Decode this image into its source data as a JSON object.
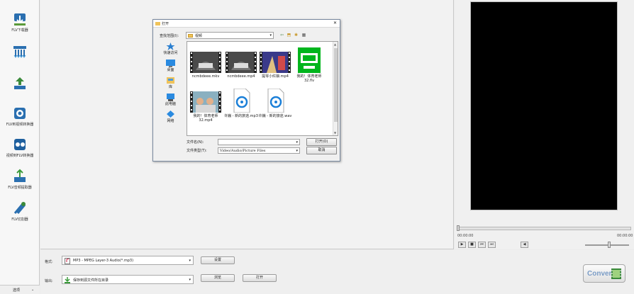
{
  "sidebar": {
    "items": [
      {
        "label": "FLV下载器",
        "icon": "download-icon"
      },
      {
        "label": "",
        "icon": "batch-convert-icon"
      },
      {
        "label": "",
        "icon": "upload-icon"
      },
      {
        "label": "FLV到视频转换器",
        "icon": "flv-to-video-icon"
      },
      {
        "label": "视频到FLV转换器",
        "icon": "video-to-flv-icon"
      },
      {
        "label": "FLV音频提取器",
        "icon": "audio-extract-icon"
      },
      {
        "label": "FLV切割器",
        "icon": "cutter-icon"
      }
    ],
    "footer_label": "选项",
    "footer_arrow": "⌄"
  },
  "dialog": {
    "title": "打开",
    "close": "✕",
    "look_in_label": "查找范围(I):",
    "look_in_value": "视频",
    "places": [
      {
        "label": "快速访问",
        "icon": "star-icon"
      },
      {
        "label": "桌面",
        "icon": "desktop-icon"
      },
      {
        "label": "库",
        "icon": "library-icon"
      },
      {
        "label": "此电脑",
        "icon": "computer-icon"
      },
      {
        "label": "网络",
        "icon": "network-icon"
      }
    ],
    "files": [
      {
        "name": "ncmbdeee.mkv",
        "kind": "video"
      },
      {
        "name": "ncmbdeee.mp4",
        "kind": "video"
      },
      {
        "name": "提琴小红娘.mp4",
        "kind": "concert"
      },
      {
        "name": "我的！体育老师32.flv",
        "kind": "iqiyi"
      },
      {
        "name": "我的！体育老师32.mp4",
        "kind": "photo"
      },
      {
        "name": "许巍 - 新的旅途.mp3",
        "kind": "audio"
      },
      {
        "name": "许巍 - 新的旅途.wav",
        "kind": "audio"
      }
    ],
    "filename_label": "文件名(N):",
    "filename_value": "",
    "filetype_label": "文件类型(T):",
    "filetype_value": "Video/Audio/Picture Files",
    "open_button": "打开(O)",
    "cancel_button": "取消"
  },
  "preview": {
    "time_start": "00:00:00",
    "time_end": "00:00:00",
    "controls": [
      "▶",
      "■",
      "⏮",
      "⏭",
      "◀"
    ],
    "volume_fraction": 0.55
  },
  "bottom": {
    "format_label": "格式:",
    "format_value": "MP3 - MPEG Layer-3 Audio(*.mp3)",
    "settings_button": "设置",
    "output_label": "输出:",
    "output_value": "保存到源文件所在目录",
    "browse_button": "浏览",
    "open_button": "打开",
    "convert_button": "Convert"
  }
}
